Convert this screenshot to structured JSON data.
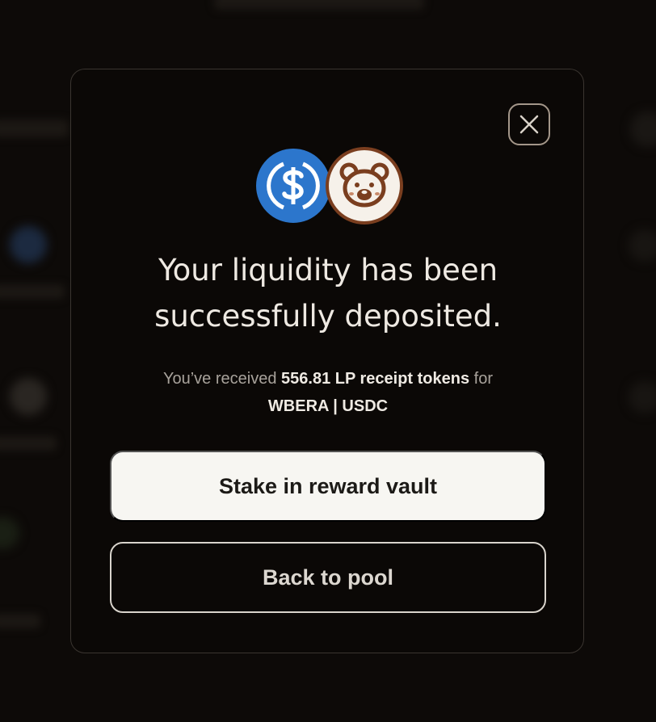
{
  "modal": {
    "close_icon": "close-icon",
    "tokens": [
      {
        "symbol": "USDC",
        "icon": "usdc-icon",
        "color": "#2c76cc"
      },
      {
        "symbol": "WBERA",
        "icon": "bera-bear-icon",
        "color": "#7a3e1f"
      }
    ],
    "headline_line1": "Your liquidity has been",
    "headline_line2": "successfully deposited.",
    "received_prefix": "You’ve received",
    "received_amount": "556.81 LP receipt tokens",
    "received_suffix": "for",
    "pool_name": "WBERA | USDC",
    "primary_button": "Stake in reward vault",
    "secondary_button": "Back to pool"
  },
  "colors": {
    "background": "#0b0806",
    "primary_button_bg": "#f7f6f2",
    "accent_text": "#eee9e2"
  }
}
